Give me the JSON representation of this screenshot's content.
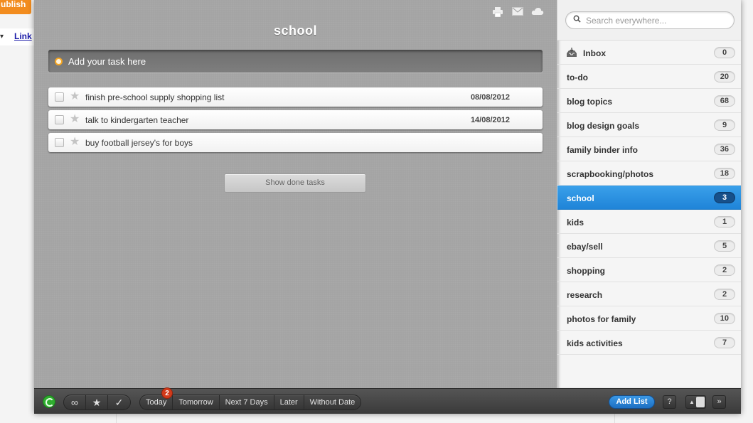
{
  "background": {
    "publish_label": "ublish",
    "link_label": "Link",
    "caret": "▾"
  },
  "header": {
    "list_title": "school",
    "icons": [
      "print-icon",
      "mail-icon",
      "cloud-icon"
    ]
  },
  "add_task": {
    "placeholder": "Add your task here"
  },
  "tasks": [
    {
      "title": "finish pre-school supply shopping list",
      "date": "08/08/2012"
    },
    {
      "title": "talk to kindergarten teacher",
      "date": "14/08/2012"
    },
    {
      "title": "buy football jersey's for boys",
      "date": ""
    }
  ],
  "show_done_label": "Show done tasks",
  "sidebar": {
    "search_placeholder": "Search everywhere...",
    "lists": [
      {
        "name": "Inbox",
        "count": "0"
      },
      {
        "name": "to-do",
        "count": "20"
      },
      {
        "name": "blog topics",
        "count": "68"
      },
      {
        "name": "blog design goals",
        "count": "9"
      },
      {
        "name": "family binder info",
        "count": "36"
      },
      {
        "name": "scrapbooking/photos",
        "count": "18"
      },
      {
        "name": "school",
        "count": "3"
      },
      {
        "name": "kids",
        "count": "1"
      },
      {
        "name": "ebay/sell",
        "count": "5"
      },
      {
        "name": "shopping",
        "count": "2"
      },
      {
        "name": "research",
        "count": "2"
      },
      {
        "name": "photos for family",
        "count": "10"
      },
      {
        "name": "kids activities",
        "count": "7"
      }
    ],
    "active_list": "school"
  },
  "toolbar": {
    "filters": [
      "Today",
      "Tomorrow",
      "Next 7 Days",
      "Later",
      "Without Date"
    ],
    "today_badge": "2",
    "add_list_label": "Add List",
    "help_label": "?",
    "collapse_label": "»",
    "toggle_label": "▲",
    "icon_buttons": [
      "infinity-icon",
      "star-icon",
      "check-icon"
    ],
    "icon_glyphs": [
      "∞",
      "★",
      "✓"
    ]
  },
  "colors": {
    "accent_blue": "#2a8fe0",
    "badge_red": "#d23a1a",
    "sync_green": "#2fae2f"
  }
}
